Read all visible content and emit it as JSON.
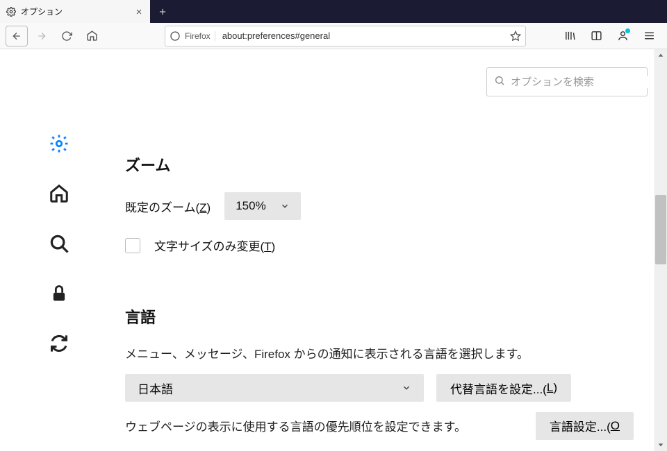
{
  "tab": {
    "title": "オプション"
  },
  "url": {
    "ff_label": "Firefox",
    "value": "about:preferences#general"
  },
  "search": {
    "placeholder": "オプションを検索"
  },
  "zoom": {
    "heading": "ズーム",
    "default_label_pre": "既定のズーム(",
    "default_label_key": "Z",
    "default_label_post": ")",
    "value": "150%",
    "text_only_pre": "文字サイズのみ変更(",
    "text_only_key": "T",
    "text_only_post": ")"
  },
  "lang": {
    "heading": "言語",
    "desc1": "メニュー、メッセージ、Firefox からの通知に表示される言語を選択します。",
    "selected": "日本語",
    "alt_btn_pre": "代替言語を設定...(",
    "alt_btn_key": "L",
    "alt_btn_post": ")",
    "desc2": "ウェブページの表示に使用する言語の優先順位を設定できます。",
    "pref_btn_pre": "言語設定...(",
    "pref_btn_key": "O",
    "pref_btn_post": ""
  }
}
